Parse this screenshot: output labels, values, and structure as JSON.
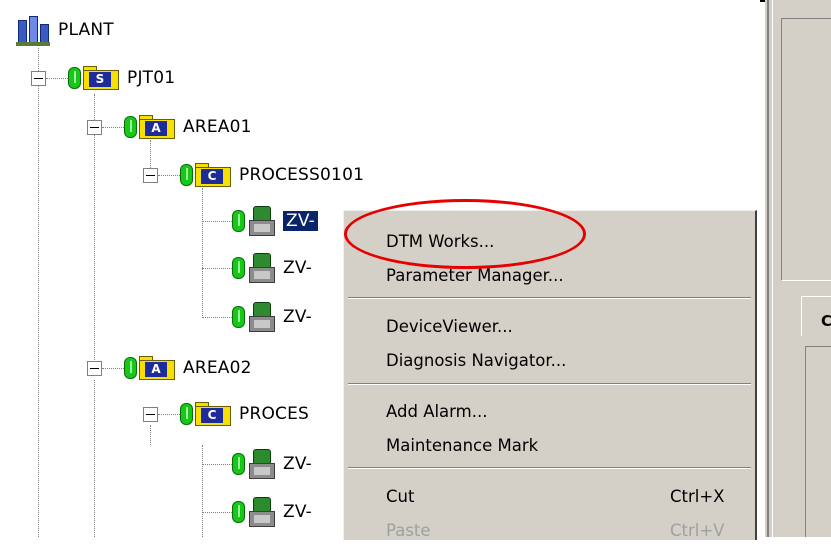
{
  "tree": {
    "root": {
      "label": "PLANT",
      "icon": "plant-icon"
    },
    "nodes": [
      {
        "label": "PJT01",
        "badge": "S",
        "icon": "folder-icon"
      },
      {
        "label": "AREA01",
        "badge": "A",
        "icon": "folder-icon"
      },
      {
        "label": "PROCESS0101",
        "badge": "C",
        "icon": "folder-icon"
      },
      {
        "label": "ZV-",
        "icon": "device-icon",
        "selected": true
      },
      {
        "label": "ZV-",
        "icon": "device-icon"
      },
      {
        "label": "ZV-",
        "icon": "device-icon"
      },
      {
        "label": "AREA02",
        "badge": "A",
        "icon": "folder-icon"
      },
      {
        "label": "PROCES",
        "badge": "C",
        "icon": "folder-icon"
      },
      {
        "label": "ZV-",
        "icon": "device-icon"
      },
      {
        "label": "ZV-",
        "icon": "device-icon"
      }
    ]
  },
  "right_pane": {
    "label": "C"
  },
  "context_menu": {
    "items": [
      {
        "label": "DTM Works...",
        "shortcut": ""
      },
      {
        "label": "Parameter Manager...",
        "shortcut": ""
      },
      {
        "label": "DeviceViewer...",
        "shortcut": ""
      },
      {
        "label": "Diagnosis Navigator...",
        "shortcut": ""
      },
      {
        "label": "Add Alarm...",
        "shortcut": ""
      },
      {
        "label": "Maintenance Mark",
        "shortcut": ""
      },
      {
        "label": "Cut",
        "shortcut": "Ctrl+X"
      },
      {
        "label": "Paste",
        "shortcut": "Ctrl+V",
        "disabled": true
      }
    ]
  },
  "colors": {
    "highlight": "#e60000",
    "selection": "#0a246a",
    "status": "#18c818",
    "folder": "#f5e000"
  }
}
